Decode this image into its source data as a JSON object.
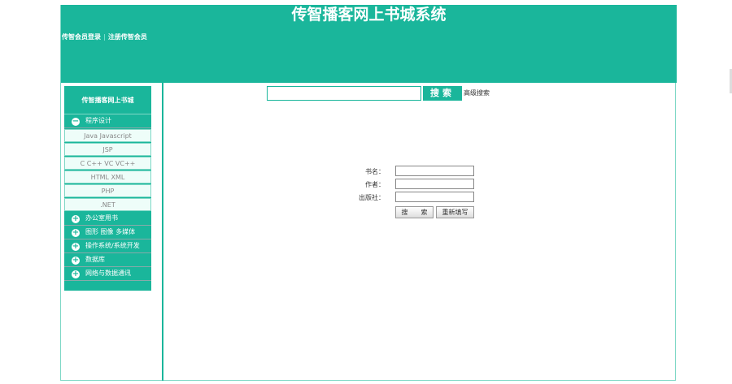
{
  "header": {
    "title": "传智播客网上书城系统",
    "login": "传智会员登录",
    "separator": "|",
    "register": "注册传智会员"
  },
  "sidebar": {
    "title": "传智播客网上书城",
    "groups": [
      {
        "label": "程序设计",
        "expanded": true,
        "items": [
          "Java Javascript",
          "JSP",
          "C C++ VC VC++",
          "HTML XML",
          "PHP",
          ".NET"
        ]
      },
      {
        "label": "办公室用书",
        "expanded": false
      },
      {
        "label": "图形 图像 多媒体",
        "expanded": false
      },
      {
        "label": "操作系统/系统开发",
        "expanded": false
      },
      {
        "label": "数据库",
        "expanded": false
      },
      {
        "label": "网络与数据通讯",
        "expanded": false
      }
    ]
  },
  "search": {
    "value": "",
    "button": "搜索",
    "advanced": "高级搜索"
  },
  "form": {
    "book_label": "书名：",
    "author_label": "作者：",
    "press_label": "出版社：",
    "book": "",
    "author": "",
    "press": "",
    "submit": "搜　　索",
    "reset": "重新填写"
  },
  "colors": {
    "accent": "#1ab69b"
  }
}
